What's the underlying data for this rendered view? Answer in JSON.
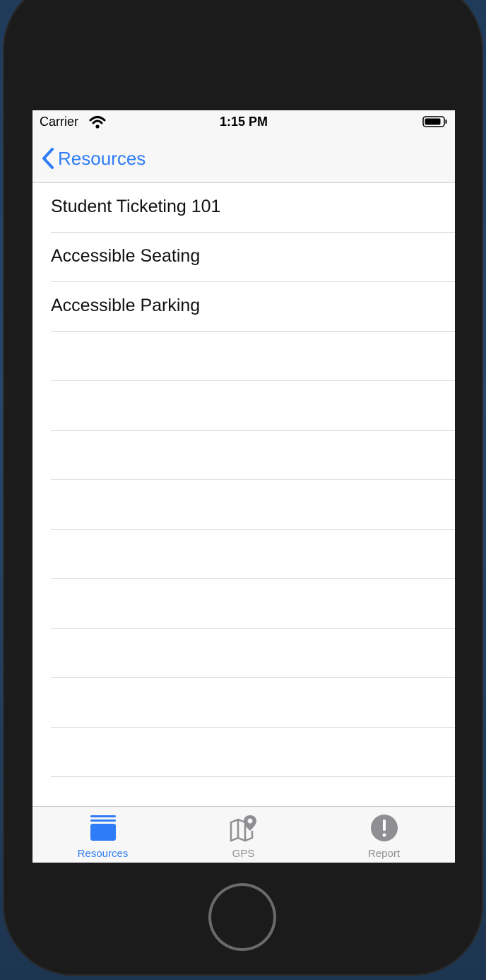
{
  "status_bar": {
    "carrier": "Carrier",
    "time": "1:15 PM"
  },
  "nav": {
    "back_label": "Resources"
  },
  "list": {
    "items": [
      {
        "label": "Student Ticketing 101"
      },
      {
        "label": "Accessible Seating"
      },
      {
        "label": "Accessible Parking"
      }
    ],
    "empty_rows": 10
  },
  "tab_bar": {
    "tabs": [
      {
        "label": "Resources",
        "icon": "stack-icon",
        "selected": true
      },
      {
        "label": "GPS",
        "icon": "map-pin-icon",
        "selected": false
      },
      {
        "label": "Report",
        "icon": "exclamation-icon",
        "selected": false
      }
    ]
  },
  "colors": {
    "accent": "#2f7df6",
    "inactive": "#8e8e93"
  }
}
